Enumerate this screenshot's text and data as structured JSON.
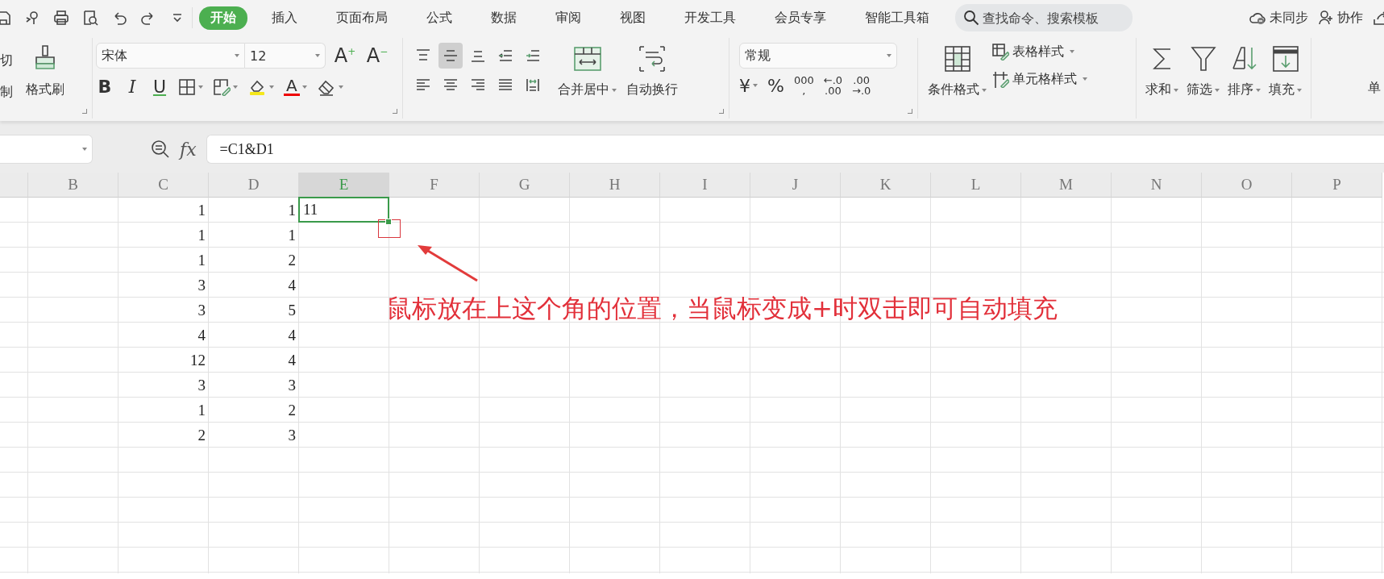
{
  "tabs": [
    {
      "label": "开始",
      "selected": true
    },
    {
      "label": "插入",
      "selected": false
    },
    {
      "label": "页面布局",
      "selected": false
    },
    {
      "label": "公式",
      "selected": false
    },
    {
      "label": "数据",
      "selected": false
    },
    {
      "label": "审阅",
      "selected": false
    },
    {
      "label": "视图",
      "selected": false
    },
    {
      "label": "开发工具",
      "selected": false
    },
    {
      "label": "会员专享",
      "selected": false
    },
    {
      "label": "智能工具箱",
      "selected": false
    }
  ],
  "search": {
    "placeholder": "查找命令、搜索模板"
  },
  "sync_status": "未同步",
  "collaborate": "协作",
  "clipboard": {
    "cut": "切",
    "copy": "制",
    "format_painter": "格式刷"
  },
  "font": {
    "family": "宋体",
    "size": "12",
    "grow": {
      "letter": "A",
      "sign": "+"
    },
    "shrink": {
      "letter": "A",
      "sign": "−"
    },
    "styles": [
      "B",
      "I",
      "U"
    ],
    "color_letter": "A"
  },
  "alignment": {
    "buttons": [
      {
        "selected": false
      },
      {
        "selected": true
      },
      {
        "selected": false
      },
      {
        "selected": false
      },
      {
        "selected": false
      },
      {
        "selected": false
      },
      {
        "selected": false
      },
      {
        "selected": false
      },
      {
        "selected": false
      },
      {
        "selected": false
      }
    ],
    "merge": "合并居中",
    "wrap": "自动换行"
  },
  "number": {
    "format": "常规",
    "currency": "¥",
    "percent": "%",
    "thousands": [
      "000",
      ","
    ],
    "increase_decimal": [
      "←.0",
      ".00"
    ],
    "decrease_decimal": [
      ".00",
      "→.0"
    ]
  },
  "styles": {
    "conditional": "条件格式",
    "table_style": "表格样式",
    "cell_style": "单元格样式"
  },
  "editing": [
    "求和",
    "筛选",
    "排序",
    "填充"
  ],
  "ribbon_cut_label": "单",
  "function_label": "fx",
  "formula": "=C1&D1",
  "columns": [
    {
      "label": "B",
      "selected": false
    },
    {
      "label": "C",
      "selected": false
    },
    {
      "label": "D",
      "selected": false
    },
    {
      "label": "E",
      "selected": true
    },
    {
      "label": "F",
      "selected": false
    },
    {
      "label": "G",
      "selected": false
    },
    {
      "label": "H",
      "selected": false
    },
    {
      "label": "I",
      "selected": false
    },
    {
      "label": "J",
      "selected": false
    },
    {
      "label": "K",
      "selected": false
    },
    {
      "label": "L",
      "selected": false
    },
    {
      "label": "M",
      "selected": false
    },
    {
      "label": "N",
      "selected": false
    },
    {
      "label": "O",
      "selected": false
    },
    {
      "label": "P",
      "selected": false
    }
  ],
  "rows": [
    {
      "column_c": {
        "value": "1",
        "selected": false
      },
      "column_d": {
        "value": "1",
        "selected": false
      },
      "column_e": {
        "value": "11",
        "selected": true
      }
    },
    {
      "column_c": {
        "value": "1",
        "selected": false
      },
      "column_d": {
        "value": "1",
        "selected": false
      }
    },
    {
      "column_c": {
        "value": "1",
        "selected": false
      },
      "column_d": {
        "value": "2",
        "selected": false
      }
    },
    {
      "column_c": {
        "value": "3",
        "selected": false
      },
      "column_d": {
        "value": "4",
        "selected": false
      }
    },
    {
      "column_c": {
        "value": "3",
        "selected": false
      },
      "column_d": {
        "value": "5",
        "selected": false
      }
    },
    {
      "column_c": {
        "value": "4",
        "selected": false
      },
      "column_d": {
        "value": "4",
        "selected": false
      }
    },
    {
      "column_c": {
        "value": "12",
        "selected": false
      },
      "column_d": {
        "value": "4",
        "selected": false
      }
    },
    {
      "column_c": {
        "value": "3",
        "selected": false
      },
      "column_d": {
        "value": "3",
        "selected": false
      }
    },
    {
      "column_c": {
        "value": "1",
        "selected": false
      },
      "column_d": {
        "value": "2",
        "selected": false
      }
    },
    {
      "column_c": {
        "value": "2",
        "selected": false
      },
      "column_d": {
        "value": "3",
        "selected": false
      }
    }
  ],
  "annotation": {
    "note": "鼠标放在上这个角的位置，当鼠标变成+时双击即可自动填充"
  }
}
